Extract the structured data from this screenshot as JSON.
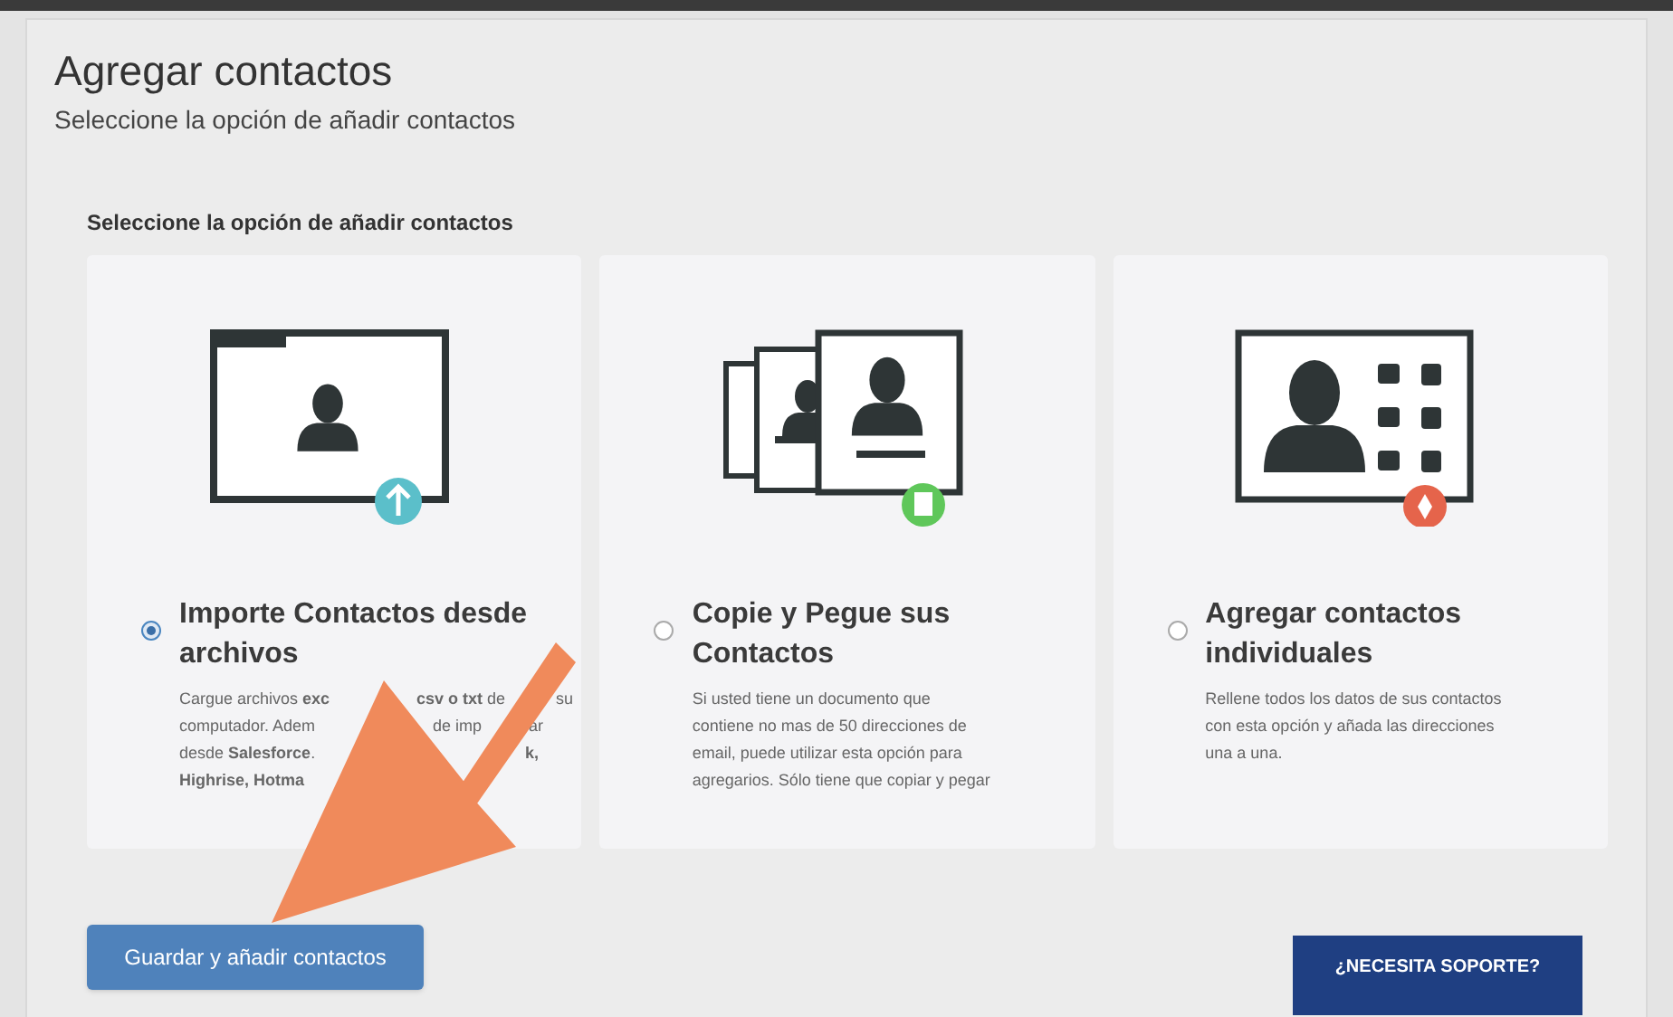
{
  "header": {
    "title": "Agregar contactos",
    "subtitle": "Seleccione la opción de añadir contactos"
  },
  "section_label": "Seleccione la opción de añadir contactos",
  "options": [
    {
      "kind": "import",
      "selected": true,
      "title": "Importe Contactos desde archivos",
      "description_lines": [
        [
          "Cargue archivos **exc**",
          "**csv o txt** de",
          "su"
        ],
        [
          "computador. Adem",
          "de imp",
          "ar"
        ],
        [
          "desde **Salesforce**.",
          "**k,**"
        ],
        [
          "**Highrise, Hotma**"
        ]
      ]
    },
    {
      "kind": "paste",
      "selected": false,
      "title": "Copie y Pegue sus Contactos",
      "description_lines": [
        [
          "Si usted tiene un documento que"
        ],
        [
          "contiene no mas de 50 direcciones de"
        ],
        [
          "email, puede utilizar esta opción para"
        ],
        [
          "agregarios. Sólo tiene que copiar y pegar"
        ]
      ]
    },
    {
      "kind": "individual",
      "selected": false,
      "title": "Agregar contactos individuales",
      "description_lines": [
        [
          "Rellene todos los datos de sus contactos"
        ],
        [
          "con esta opción y añada las direcciones"
        ],
        [
          "una a una."
        ]
      ]
    }
  ],
  "save_button": "Guardar y añadir contactos",
  "support_banner": {
    "title": "¿NECESITA SOPORTE?"
  }
}
